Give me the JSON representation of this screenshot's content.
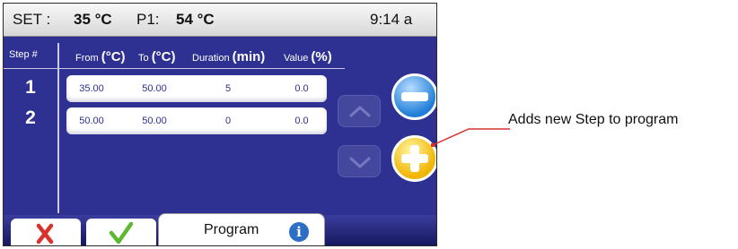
{
  "status": {
    "set_label": "SET :",
    "set_value": "35 °C",
    "p1_label": "P1:",
    "p1_value": "54 °C",
    "time": "9:14 a"
  },
  "table": {
    "headers": {
      "step": "Step #",
      "from_word": "From",
      "from_unit": "(°C)",
      "to_word": "To",
      "to_unit": "(°C)",
      "duration_word": "Duration",
      "duration_unit": "(min)",
      "value_word": "Value",
      "value_unit": "(%)"
    },
    "rows": [
      {
        "step": "1",
        "from": "35.00",
        "to": "50.00",
        "duration": "5",
        "value": "0.0"
      },
      {
        "step": "2",
        "from": "50.00",
        "to": "50.00",
        "duration": "0",
        "value": "0.0"
      }
    ]
  },
  "footer": {
    "program_label": "Program"
  },
  "callout": {
    "text": "Adds new Step to program"
  },
  "colors": {
    "screen_bg": "#2e3191",
    "cancel_red": "#d9302c",
    "confirm_green": "#5cb82e",
    "add_yellow": "#f1b400",
    "remove_blue": "#1f7fd8"
  }
}
